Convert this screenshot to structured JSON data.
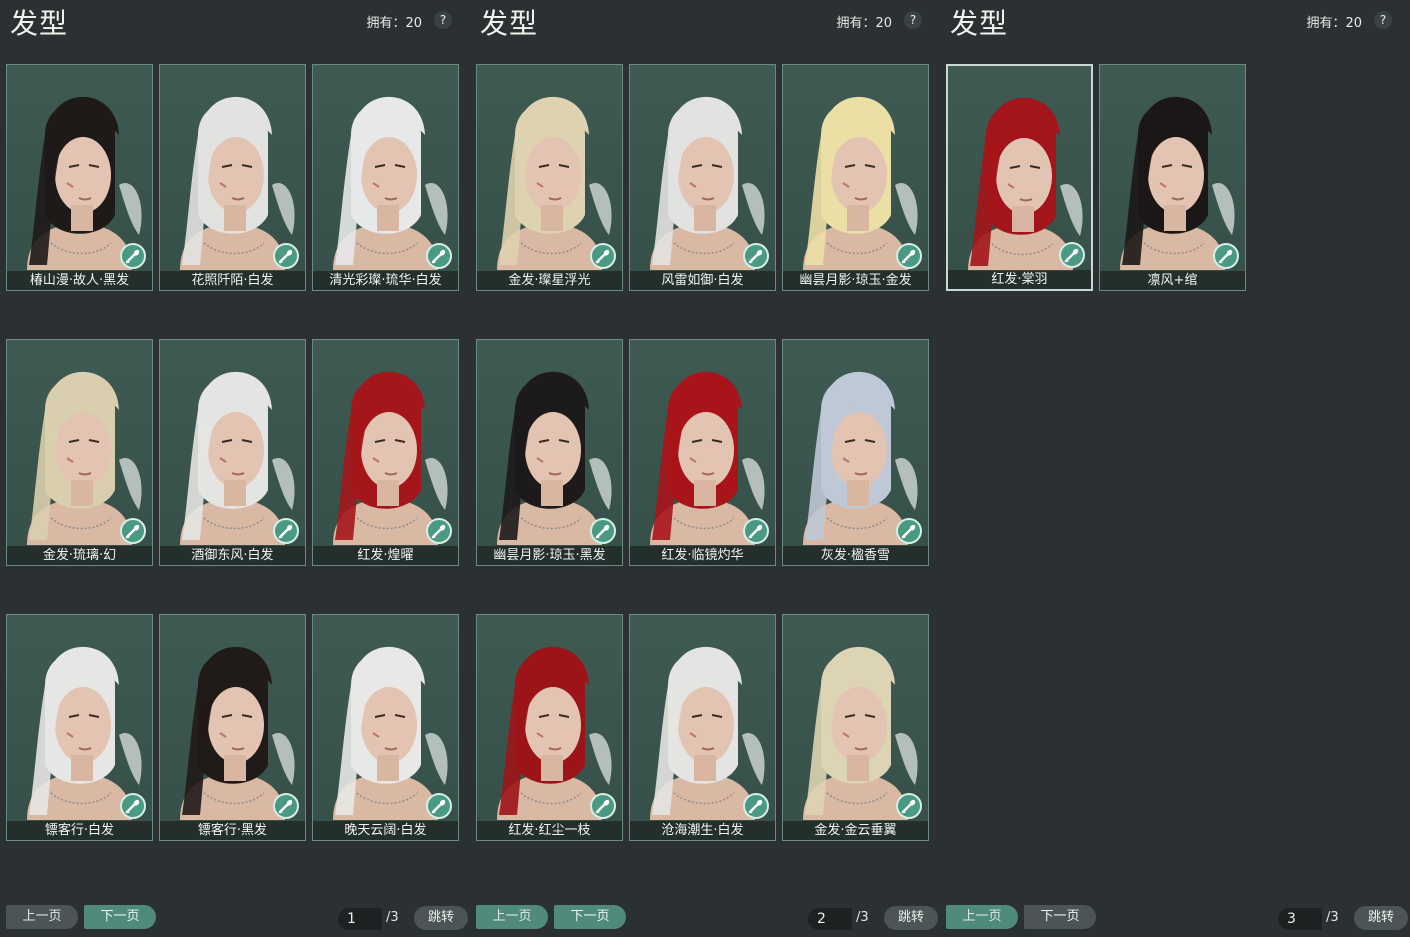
{
  "colors": {
    "background": "#2b3032",
    "card": "#3e5a52",
    "accent": "#4f8a7a"
  },
  "panels": [
    {
      "title": "发型",
      "owned": "拥有：20",
      "help": "?",
      "cards": [
        {
          "label": "椿山漫·故人·黑发",
          "hair": "#1e1a18",
          "selected": false
        },
        {
          "label": "花照阡陌·白发",
          "hair": "#e2e2e0",
          "selected": false
        },
        {
          "label": "清光彩璨·琉华·白发",
          "hair": "#e6e8ea",
          "selected": false
        },
        {
          "label": "金发·琉璃·幻",
          "hair": "#d9cfae",
          "selected": false
        },
        {
          "label": "酒御东风·白发",
          "hair": "#e4e4e2",
          "selected": false
        },
        {
          "label": "红发·煌曜",
          "hair": "#a5161a",
          "selected": false
        },
        {
          "label": "镖客行·白发",
          "hair": "#e6e6e4",
          "selected": false
        },
        {
          "label": "镖客行·黑发",
          "hair": "#201a18",
          "selected": false
        },
        {
          "label": "晚天云阔·白发",
          "hair": "#e8e8e6",
          "selected": false
        }
      ],
      "pager": {
        "prev": "上一页",
        "next": "下一页",
        "page": "1",
        "total": "/3",
        "jump": "跳转",
        "prev_active": false
      }
    },
    {
      "title": "发型",
      "owned": "拥有：20",
      "help": "?",
      "cards": [
        {
          "label": "金发·璨星浮光",
          "hair": "#dfd2b0",
          "selected": false
        },
        {
          "label": "风雷如御·白发",
          "hair": "#e2e2e0",
          "selected": false
        },
        {
          "label": "幽昙月影·琼玉·金发",
          "hair": "#ecdfa6",
          "selected": false
        },
        {
          "label": "幽昙月影·琼玉·黑发",
          "hair": "#1c1a1a",
          "selected": false
        },
        {
          "label": "红发·临镜灼华",
          "hair": "#a8141a",
          "selected": false
        },
        {
          "label": "灰发·楹香雪",
          "hair": "#bfc8d6",
          "selected": false
        },
        {
          "label": "红发·红尘一枝",
          "hair": "#9d1418",
          "selected": false
        },
        {
          "label": "沧海潮生·白发",
          "hair": "#e4e4e2",
          "selected": false
        },
        {
          "label": "金发·金云垂翼",
          "hair": "#ddd4b4",
          "selected": false
        }
      ],
      "pager": {
        "prev": "上一页",
        "next": "下一页",
        "page": "2",
        "total": "/3",
        "jump": "跳转",
        "prev_active": true
      }
    },
    {
      "title": "发型",
      "owned": "拥有：20",
      "help": "?",
      "cards": [
        {
          "label": "红发·棠羽",
          "hair": "#a3151a",
          "selected": true
        },
        {
          "label": "凛风+绾",
          "hair": "#1b1716",
          "selected": false
        }
      ],
      "pager": {
        "prev": "上一页",
        "next": "下一页",
        "page": "3",
        "total": "/3",
        "jump": "跳转",
        "prev_active": true,
        "next_inactive": true
      }
    }
  ]
}
